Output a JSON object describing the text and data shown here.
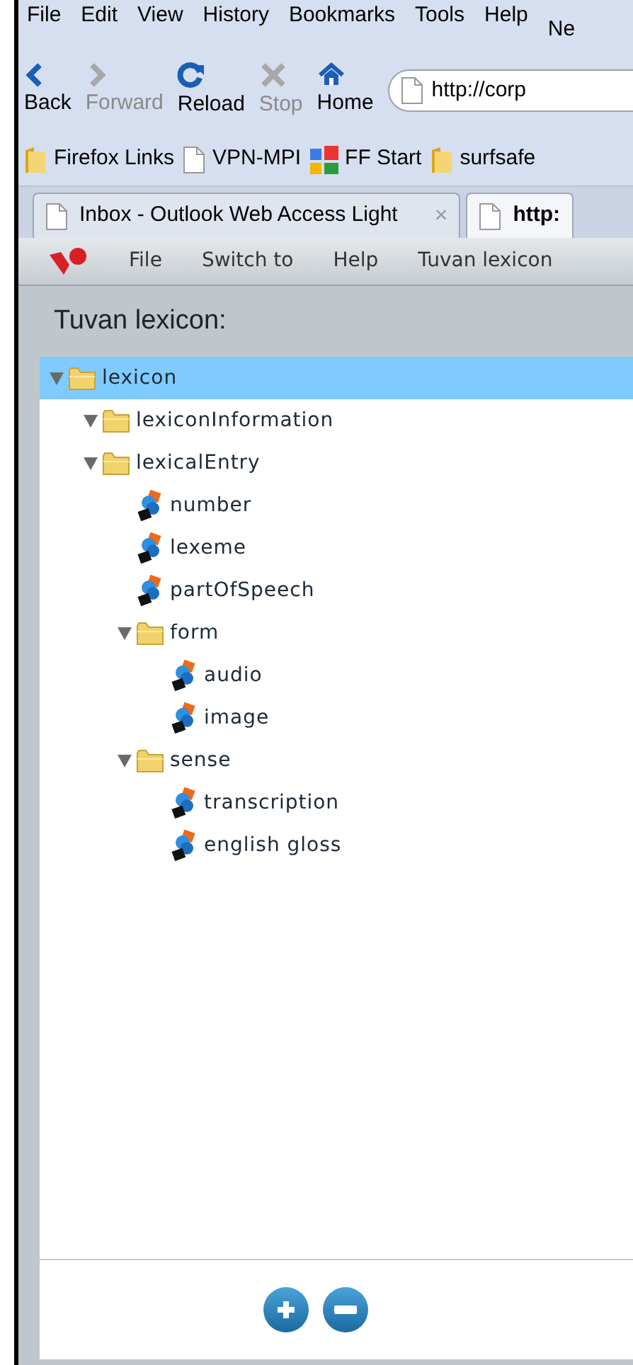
{
  "menu_bar": {
    "items": [
      "File",
      "Edit",
      "View",
      "History",
      "Bookmarks",
      "Tools",
      "Help"
    ],
    "extra": "Ne"
  },
  "nav_buttons": [
    {
      "label": "Back",
      "kind": "back",
      "disabled": false
    },
    {
      "label": "Forward",
      "kind": "forward",
      "disabled": true
    },
    {
      "label": "Reload",
      "kind": "reload",
      "disabled": false
    },
    {
      "label": "Stop",
      "kind": "stop",
      "disabled": true
    },
    {
      "label": "Home",
      "kind": "home",
      "disabled": false
    }
  ],
  "address": {
    "value": "http://corp"
  },
  "bookmarks": [
    {
      "label": "Firefox Links",
      "kind": "folder"
    },
    {
      "label": "VPN-MPI",
      "kind": "page"
    },
    {
      "label": "FF Start",
      "kind": "google"
    },
    {
      "label": "surfsafe",
      "kind": "folder"
    }
  ],
  "tabs": [
    {
      "title": "Inbox - Outlook Web Access Light",
      "selected": false,
      "close": "×"
    },
    {
      "title": "http:",
      "selected": true
    }
  ],
  "app_menu": [
    "File",
    "Switch to",
    "Help",
    "Tuvan lexicon"
  ],
  "panel_title": "Tuvan lexicon:",
  "tree": [
    {
      "label": "lexicon",
      "kind": "folder",
      "expanded": true,
      "selected": true,
      "children": [
        {
          "label": "lexiconInformation",
          "kind": "folder",
          "expanded": true,
          "selected": false
        },
        {
          "label": "lexicalEntry",
          "kind": "folder",
          "expanded": true,
          "selected": false,
          "children": [
            {
              "label": "number",
              "kind": "element",
              "selected": false
            },
            {
              "label": "lexeme",
              "kind": "element",
              "selected": false
            },
            {
              "label": "partOfSpeech",
              "kind": "element",
              "selected": false
            },
            {
              "label": "form",
              "kind": "folder",
              "expanded": true,
              "selected": false,
              "children": [
                {
                  "label": "audio",
                  "kind": "element",
                  "selected": false
                },
                {
                  "label": "image",
                  "kind": "element",
                  "selected": false
                }
              ]
            },
            {
              "label": "sense",
              "kind": "folder",
              "expanded": true,
              "selected": false,
              "children": [
                {
                  "label": "transcription",
                  "kind": "element",
                  "selected": false
                },
                {
                  "label": "english gloss",
                  "kind": "element",
                  "selected": false
                }
              ]
            }
          ]
        }
      ]
    }
  ]
}
